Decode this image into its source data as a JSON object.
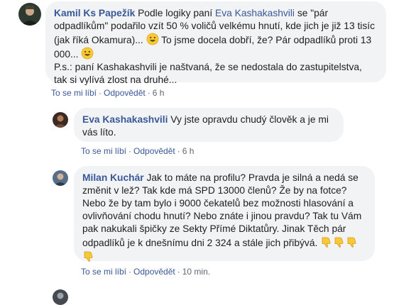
{
  "comments": [
    {
      "author": "Kamil Ks Papežík",
      "text_1": "Podle logiky paní ",
      "mention": "Eva Kashakashvili",
      "text_2": " se \"pár odpadlíkům\" podařilo vzít 50 % voličů velkému hnutí, kde jich je již 13 tisíc (jak říká Okamura)... ",
      "text_3": " To jsme docela dobří, že? Pár odpadlíků proti 13 000... ",
      "text_4": "P.s.: paní Kashakashvili je naštvaná, že se nedostala do zastupitelstva, tak si vylívá zlost na druhé...",
      "like": "To se mi líbí",
      "reply": "Odpovědět",
      "time": "6 h",
      "emoji": "smiley-emoji"
    },
    {
      "author": "Eva Kashakashvili",
      "text": "Vy jste opravdu chudý člověk a je mi vás líto.",
      "like": "To se mi líbí",
      "reply": "Odpovědět",
      "time": "6 h"
    },
    {
      "author": "Milan Kuchár",
      "text": "Jak to máte na profilu? Pravda je silná a nedá se změnit v lež? Tak kde má SPD 13000 členů? Že by na fotce? Nebo že by tam bylo i 9000 čekatelů bez možnosti hlasování a ovlivňování chodu hnutí? Nebo znáte i jinou pravdu? Tak tu Vám pak nakukali špičky ze Sekty Přímé Diktatůry. Jinak Těch pár odpadlíků je k dnešnímu dni 2 324 a stále jich přibývá. ",
      "like": "To se mi líbí",
      "reply": "Odpovědět",
      "time": "10 min.",
      "emoji": "thumbs-down-emoji"
    }
  ],
  "colors": {
    "bubble": "#f2f3f5",
    "link": "#385898",
    "meta": "#606770"
  }
}
